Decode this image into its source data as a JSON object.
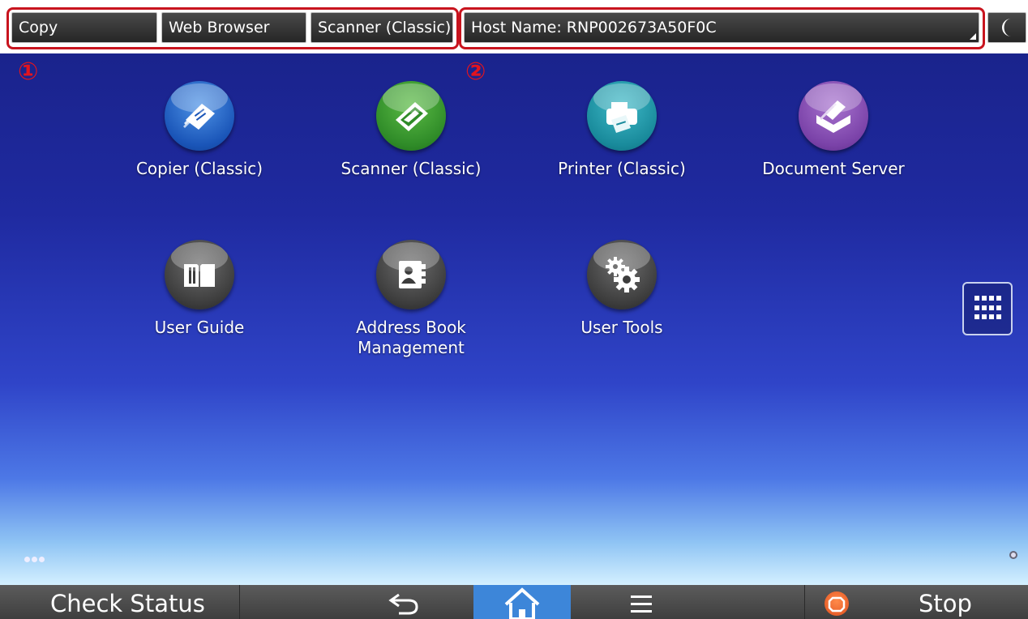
{
  "top_bar": {
    "tabs": [
      {
        "label": "Copy"
      },
      {
        "label": "Web Browser"
      },
      {
        "label": "Scanner (Classic)"
      }
    ],
    "host_name": "Host Name: RNP002673A50F0C",
    "energy_saver_icon": "moon-icon"
  },
  "annotations": {
    "marker_1": "①",
    "marker_2": "②",
    "highlight_color": "#c8141e"
  },
  "apps": [
    {
      "label": "Copier (Classic)",
      "icon": "copier-icon",
      "color": "#1a55b8"
    },
    {
      "label": "Scanner (Classic)",
      "icon": "scanner-icon",
      "color": "#2f8b28"
    },
    {
      "label": "Printer (Classic)",
      "icon": "printer-icon",
      "color": "#198a9b"
    },
    {
      "label": "Document Server",
      "icon": "document-server-icon",
      "color": "#7a42a8"
    },
    {
      "label": "User Guide",
      "icon": "user-guide-icon",
      "color": "#3c3c3c"
    },
    {
      "label": "Address Book\nManagement",
      "icon": "address-book-icon",
      "color": "#3c3c3c"
    },
    {
      "label": "User Tools",
      "icon": "user-tools-icon",
      "color": "#3c3c3c"
    }
  ],
  "side": {
    "keypad_icon": "keypad-grid-icon"
  },
  "bottom_bar": {
    "check_status": "Check Status",
    "back_icon": "back-arrow-icon",
    "home_icon": "home-icon",
    "menu_icon": "menu-icon",
    "stop_icon": "stop-icon",
    "stop_label": "Stop",
    "home_active_color": "#3d86d9",
    "stop_color": "#e0501e"
  }
}
